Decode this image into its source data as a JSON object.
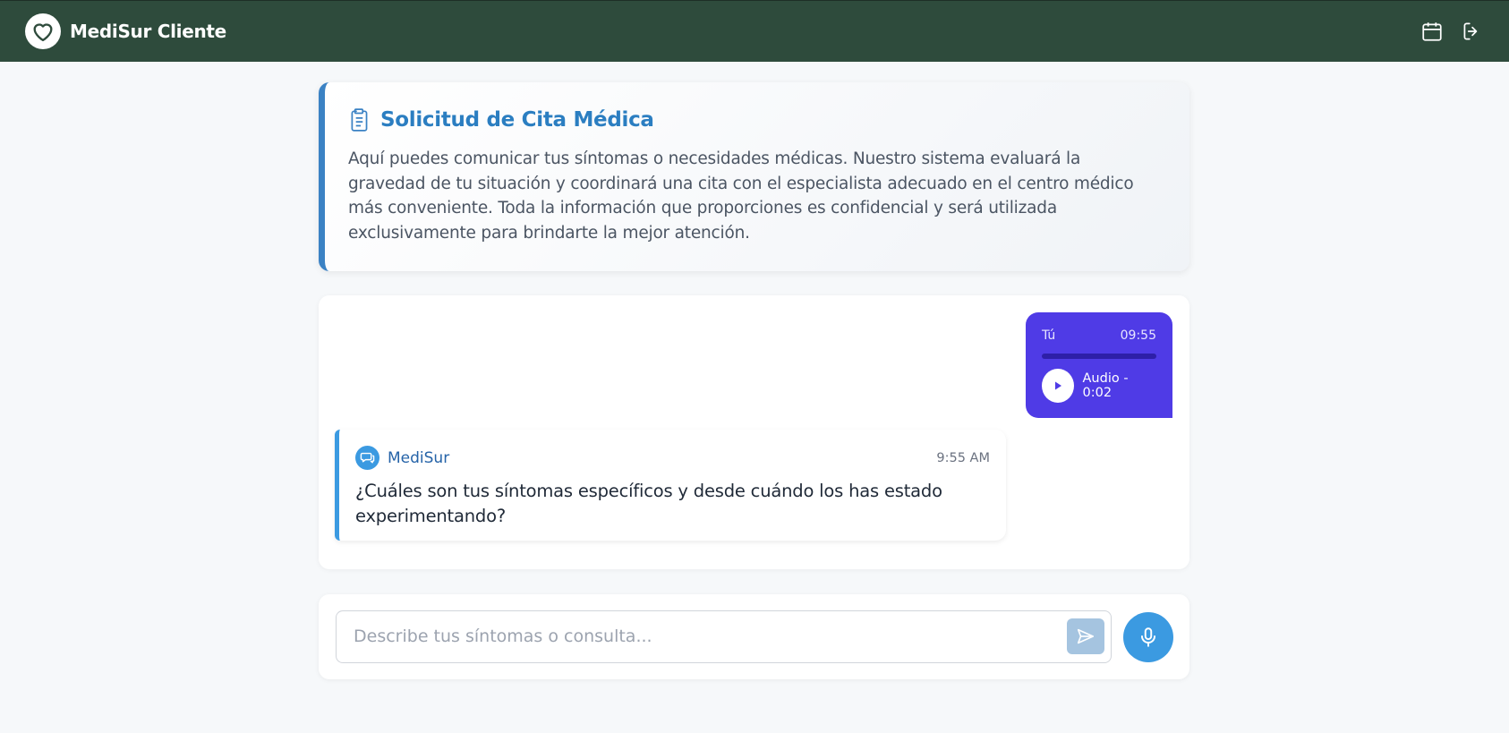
{
  "navbar": {
    "brand_name": "MediSur Cliente",
    "logo_icon": "heart-icon",
    "actions": [
      {
        "icon": "calendar-icon"
      },
      {
        "icon": "logout-icon"
      }
    ]
  },
  "info": {
    "icon": "clipboard-icon",
    "title": "Solicitud de Cita Médica",
    "text": "Aquí puedes comunicar tus síntomas o necesidades médicas. Nuestro sistema evaluará la gravedad de tu situación y coordinará una cita con el especialista adecuado en el centro médico más conveniente. Toda la información que proporciones es confidencial y será utilizada exclusivamente para brindarte la mejor atención."
  },
  "chat": {
    "messages": [
      {
        "sender": "Tú",
        "time": "09:55",
        "type": "audio",
        "audio_label": "Audio - 0:02",
        "progress": 0
      },
      {
        "sender": "MediSur",
        "time": "9:55 AM",
        "type": "text",
        "text": "¿Cuáles son tus síntomas específicos y desde cuándo los has estado experimentando?"
      }
    ]
  },
  "composer": {
    "placeholder": "Describe tus síntomas o consulta...",
    "value": ""
  },
  "colors": {
    "navbar": "#2e4b3c",
    "accent_blue": "#3b9ae1",
    "user_bubble": "#4f3be6",
    "title_blue": "#2b7ec1"
  }
}
